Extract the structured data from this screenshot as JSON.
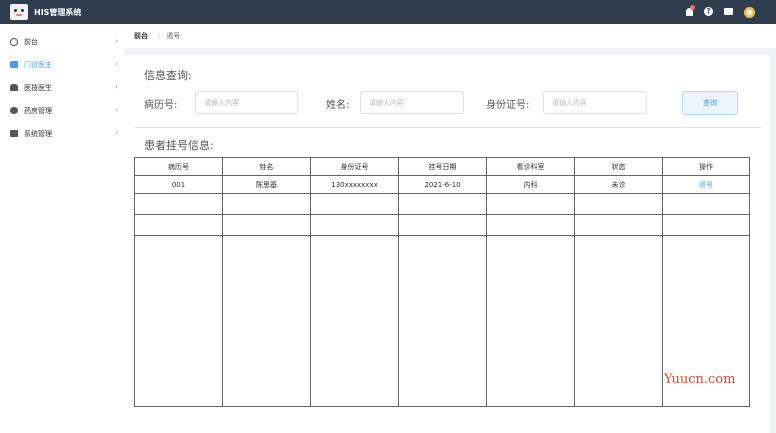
{
  "app": {
    "title": "HIS管理系统"
  },
  "sidebar": {
    "items": [
      {
        "label": "前台",
        "icon": "front-desk-icon"
      },
      {
        "label": "门诊医生",
        "icon": "outpatient-icon",
        "active": true
      },
      {
        "label": "医技医生",
        "icon": "medtech-icon"
      },
      {
        "label": "药房管理",
        "icon": "pharmacy-icon"
      },
      {
        "label": "系统管理",
        "icon": "system-icon"
      }
    ]
  },
  "breadcrumb": {
    "first": "前台",
    "separator": "/",
    "current": "退号"
  },
  "query": {
    "title": "信息查询:",
    "record_label": "病历号:",
    "name_label": "姓名:",
    "id_label": "身份证号:",
    "placeholder": "请输入内容",
    "button": "查询"
  },
  "patients": {
    "title": "患者挂号信息:",
    "columns": [
      "病历号",
      "姓名",
      "身份证号",
      "挂号日期",
      "看诊科室",
      "状态",
      "操作"
    ],
    "rows": [
      [
        "001",
        "陈思基",
        "130xxxxxxxx",
        "2021-6-10",
        "内科",
        "未诊",
        "退号"
      ]
    ]
  },
  "watermark": "Yuucn.com",
  "colors": {
    "topbar": "#2f3d4f",
    "accent": "#409eff",
    "watermark": "#e0452b"
  }
}
